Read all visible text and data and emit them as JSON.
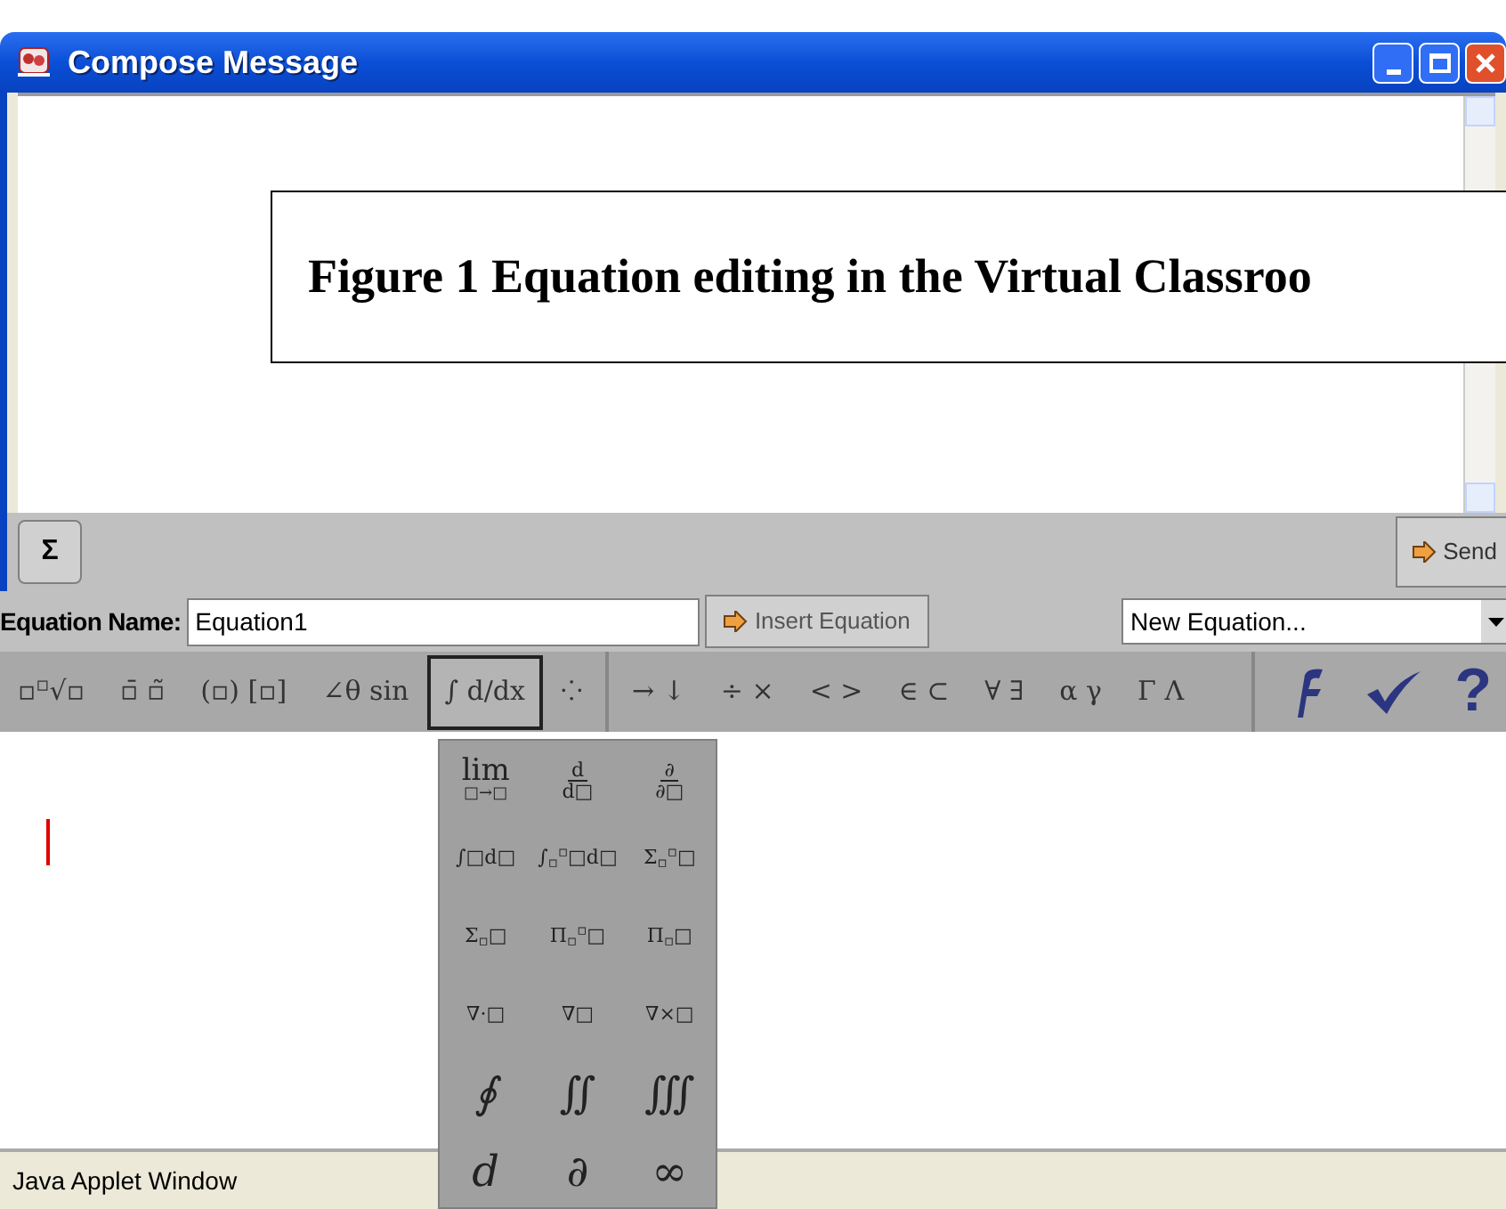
{
  "window": {
    "title": "Compose Message"
  },
  "caption": "Figure 1 Equation editing in the Virtual Classroo",
  "toolbar": {
    "sigma_button": "Σ",
    "send_button": "Send"
  },
  "equation_row": {
    "label": "Equation Name:",
    "name_value": "Equation1",
    "insert_button": "Insert Equation",
    "template_select": "New Equation..."
  },
  "palette": [
    {
      "text": "▫$^{▫}$√▫",
      "selected": false
    },
    {
      "text": "▫̄ ▫̃",
      "selected": false
    },
    {
      "text": "(▫) [▫]",
      "selected": false
    },
    {
      "text": "∠θ sin",
      "selected": false
    },
    {
      "text": "∫ d/dx",
      "selected": true
    },
    {
      "text": "⁘",
      "selected": false
    },
    {
      "text": "→ ↓",
      "selected": false
    },
    {
      "text": "÷ ×",
      "selected": false
    },
    {
      "text": "< >",
      "selected": false
    },
    {
      "text": "∈ ⊂",
      "selected": false
    },
    {
      "text": "∀ ∃",
      "selected": false
    },
    {
      "text": "α γ",
      "selected": false
    },
    {
      "text": "Γ Λ",
      "selected": false
    }
  ],
  "help_button": "?",
  "popup": [
    {
      "kind": "limit",
      "main": "lim",
      "sub": "□→□"
    },
    {
      "kind": "frac",
      "num": "d",
      "den": "d□"
    },
    {
      "kind": "frac",
      "num": "∂",
      "den": "∂□"
    },
    {
      "kind": "plain",
      "text": "∫□d□"
    },
    {
      "kind": "plain",
      "text": "∫$_{▫}$$^{▫}$□d□"
    },
    {
      "kind": "plain",
      "text": "Σ$_{▫}$$^{▫}$□"
    },
    {
      "kind": "plain",
      "text": "Σ$_{▫}$□"
    },
    {
      "kind": "plain",
      "text": "Π$_{▫}$$^{▫}$□"
    },
    {
      "kind": "plain",
      "text": "Π$_{▫}$□"
    },
    {
      "kind": "plain",
      "text": "∇·□"
    },
    {
      "kind": "plain",
      "text": "∇□"
    },
    {
      "kind": "plain",
      "text": "∇×□"
    },
    {
      "kind": "big",
      "text": "∮"
    },
    {
      "kind": "big",
      "text": "∬"
    },
    {
      "kind": "big",
      "text": "∭"
    },
    {
      "kind": "big",
      "text": "d"
    },
    {
      "kind": "big",
      "text": "∂"
    },
    {
      "kind": "big",
      "text": "∞"
    }
  ],
  "status_bar": "Java Applet Window"
}
